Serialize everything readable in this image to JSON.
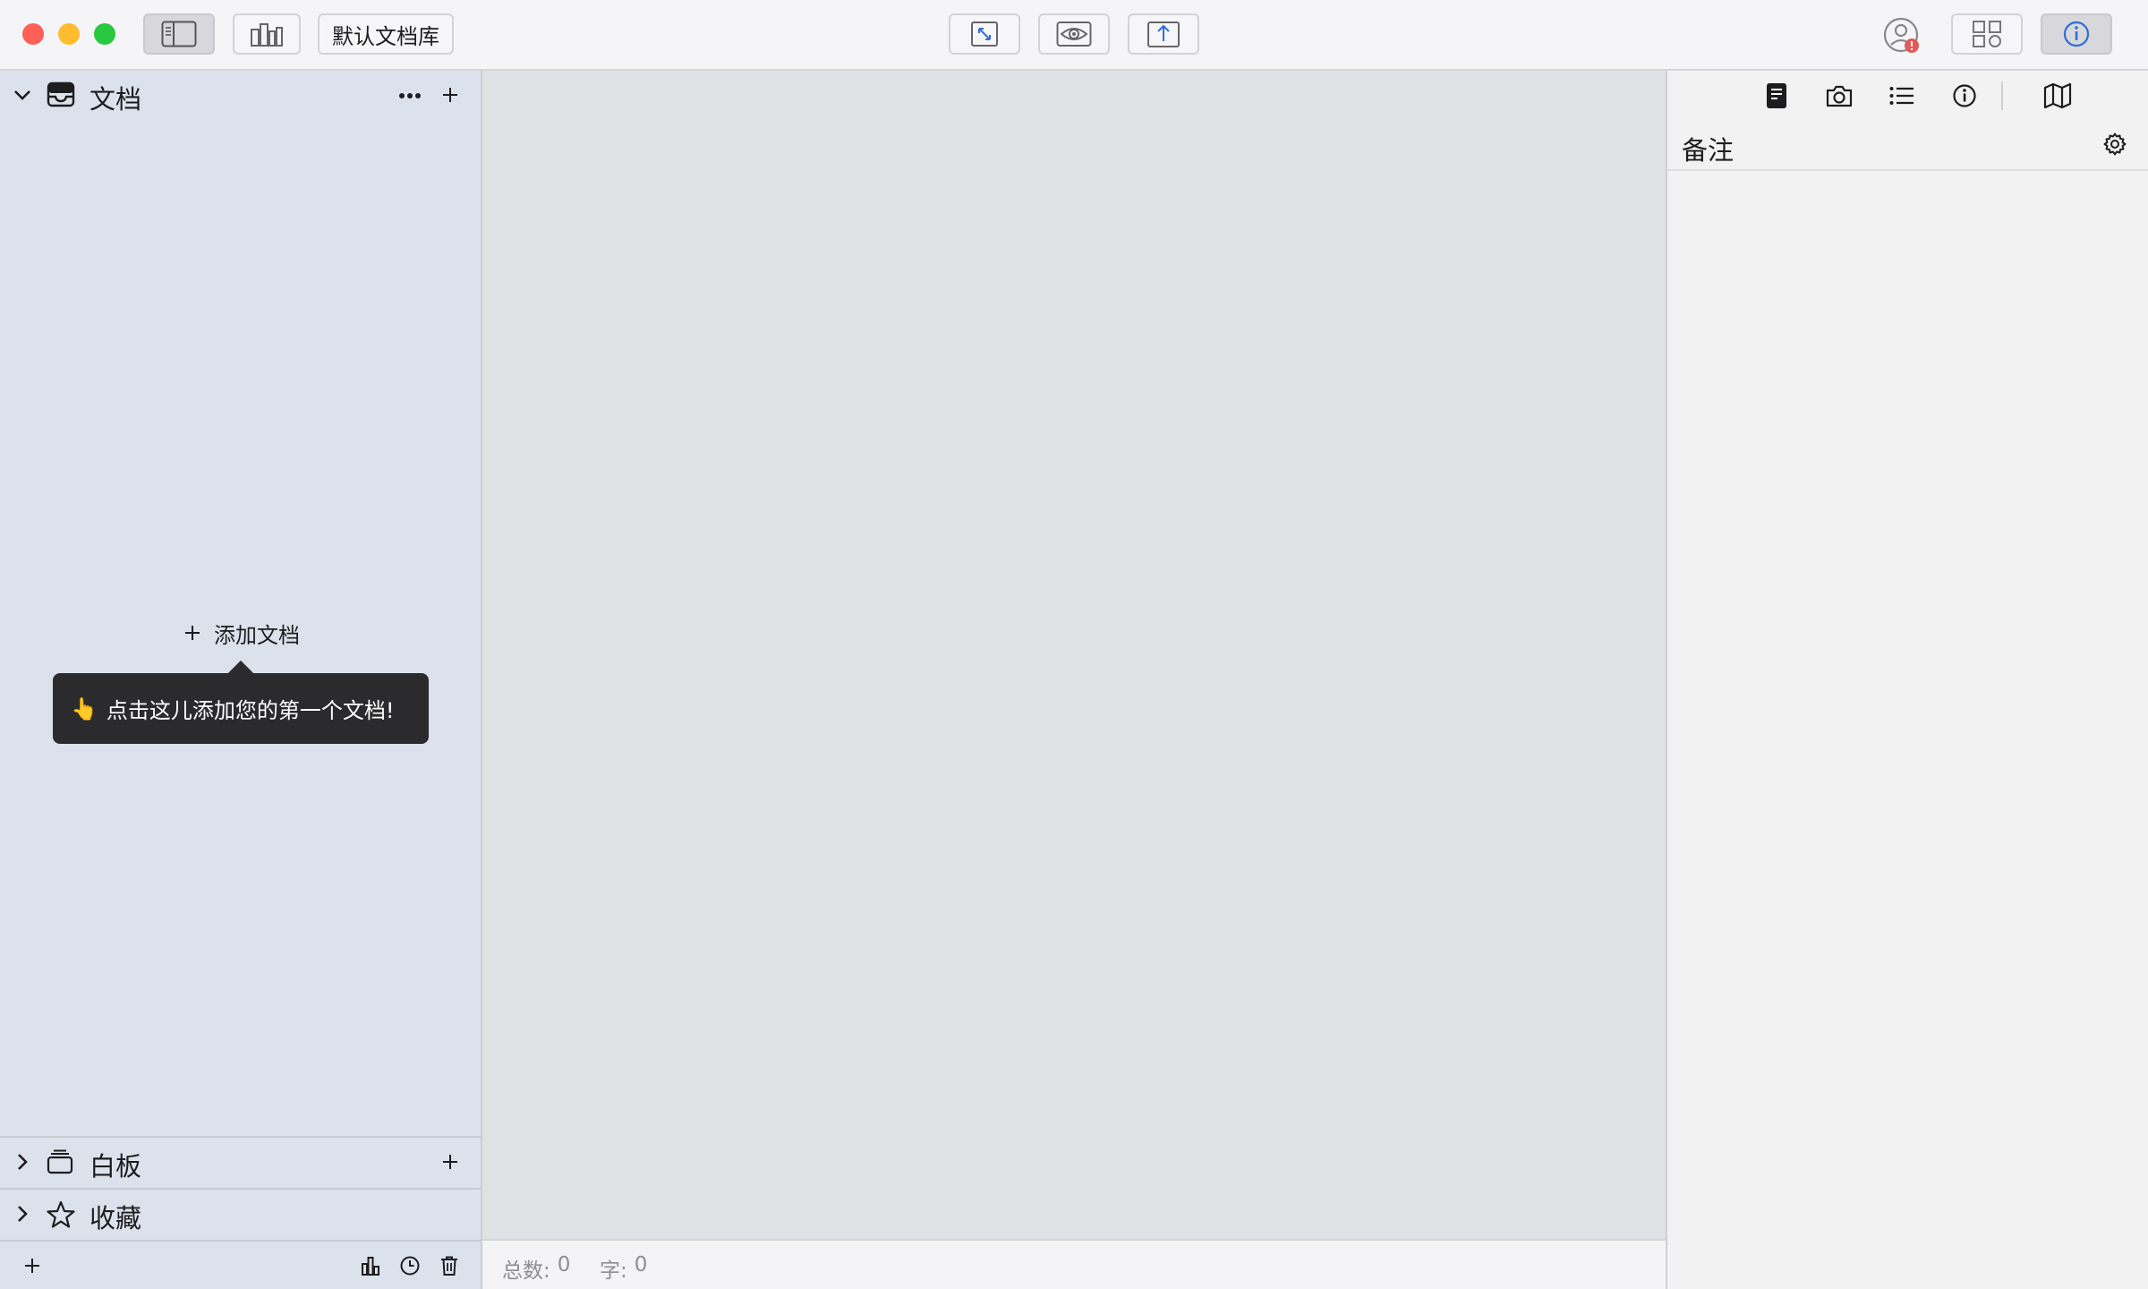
{
  "window": {
    "library_button_label": "默认文档库"
  },
  "sidebar": {
    "documents_section": {
      "title": "文档"
    },
    "add_document_label": "添加文档",
    "tooltip_text": "点击这儿添加您的第一个文档!",
    "tooltip_emoji": "👆",
    "whiteboard_section": {
      "title": "白板"
    },
    "favorites_section": {
      "title": "收藏"
    }
  },
  "statusbar": {
    "total_label": "总数:",
    "total_value": "0",
    "chars_label": "字:",
    "chars_value": "0"
  },
  "inspector": {
    "title": "备注",
    "tabs": [
      "note-icon",
      "camera-icon",
      "list-icon",
      "info-icon",
      "map-icon"
    ]
  },
  "colors": {
    "close": "#ff5f57",
    "minimize": "#febc2e",
    "zoom": "#28c840",
    "sidebar_bg": "#dce2ec",
    "tooltip_bg": "#2b2b2d",
    "user_badge": "#e05a5a"
  }
}
